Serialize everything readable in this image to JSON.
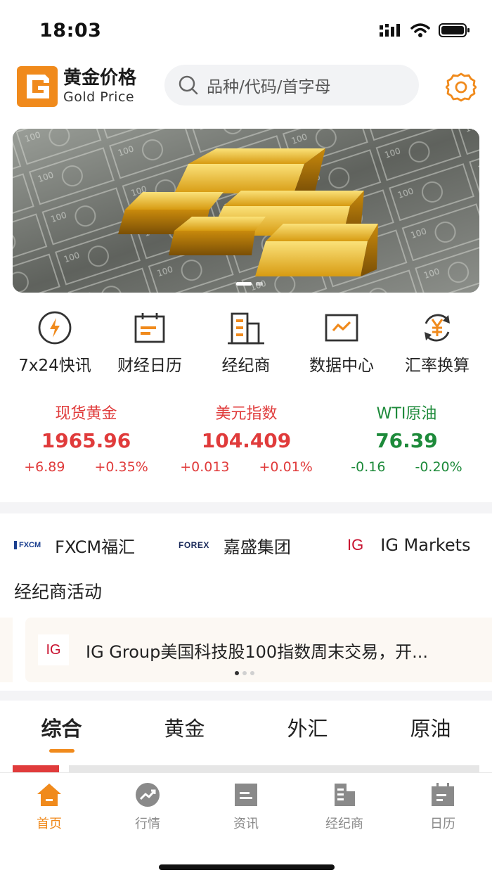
{
  "status_bar": {
    "time": "18:03"
  },
  "header": {
    "app_name_cn": "黄金价格",
    "app_name_en": "Gold Price",
    "search_placeholder": "品种/代码/首字母"
  },
  "banner": {
    "page_index": 1,
    "page_count": 2
  },
  "shortcuts": [
    {
      "label": "7x24快讯",
      "icon": "lightning-icon"
    },
    {
      "label": "财经日历",
      "icon": "calendar-icon"
    },
    {
      "label": "经纪商",
      "icon": "building-icon"
    },
    {
      "label": "数据中心",
      "icon": "chart-icon"
    },
    {
      "label": "汇率换算",
      "icon": "currency-exchange-icon"
    }
  ],
  "quotes": [
    {
      "name": "现货黄金",
      "price": "1965.96",
      "change": "+6.89",
      "change_pct": "+0.35%",
      "direction": "up"
    },
    {
      "name": "美元指数",
      "price": "104.409",
      "change": "+0.013",
      "change_pct": "+0.01%",
      "direction": "up"
    },
    {
      "name": "WTI原油",
      "price": "76.39",
      "change": "-0.16",
      "change_pct": "-0.20%",
      "direction": "down"
    }
  ],
  "brokers": [
    {
      "logo": "FXCM",
      "name": "FXCM福汇"
    },
    {
      "logo": "FOREX",
      "name": "嘉盛集团"
    },
    {
      "logo": "IG",
      "name": "IG Markets"
    }
  ],
  "broker_activity": {
    "title": "经纪商活动",
    "logo": "IG",
    "headline": "IG Group美国科技股100指数周末交易，开...",
    "page_index": 1,
    "page_count": 3
  },
  "tabs": [
    {
      "label": "综合",
      "active": true
    },
    {
      "label": "黄金",
      "active": false
    },
    {
      "label": "外汇",
      "active": false
    },
    {
      "label": "原油",
      "active": false
    }
  ],
  "bottom_nav": [
    {
      "label": "首页",
      "icon": "home-icon",
      "active": true
    },
    {
      "label": "行情",
      "icon": "trend-icon",
      "active": false
    },
    {
      "label": "资讯",
      "icon": "news-icon",
      "active": false
    },
    {
      "label": "经纪商",
      "icon": "building-icon",
      "active": false
    },
    {
      "label": "日历",
      "icon": "calendar-icon",
      "active": false
    }
  ],
  "colors": {
    "accent": "#f08a1c",
    "up": "#e03b3b",
    "down": "#1d8a3a"
  }
}
